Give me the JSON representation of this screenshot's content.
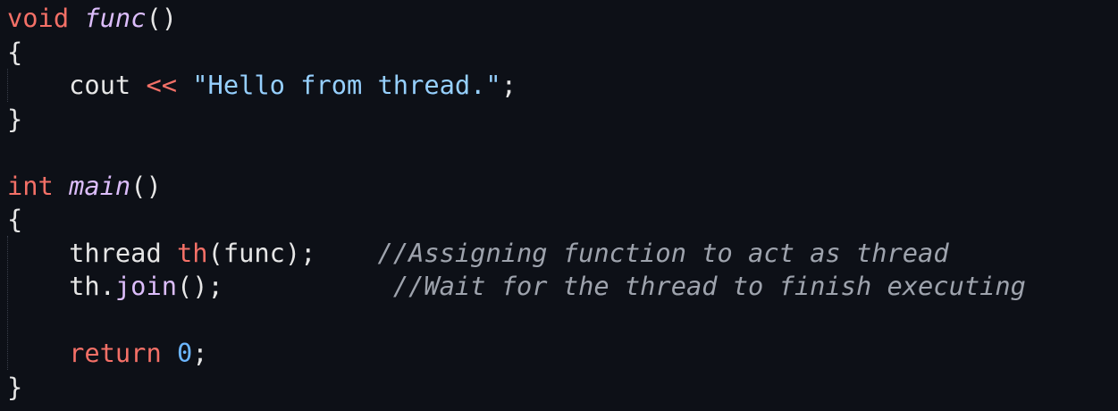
{
  "editor": {
    "lines": [
      [
        {
          "text": "void",
          "cls": "kw",
          "name": "keyword-token"
        },
        {
          "text": " ",
          "cls": "plain",
          "name": "whitespace-token"
        },
        {
          "text": "func",
          "cls": "fn",
          "name": "function-name-token"
        },
        {
          "text": "()",
          "cls": "plain",
          "name": "punctuation-token"
        }
      ],
      [
        {
          "text": "{",
          "cls": "plain",
          "name": "brace-token"
        }
      ],
      [
        {
          "text": "    cout ",
          "cls": "plain",
          "name": "identifier-token"
        },
        {
          "text": "<<",
          "cls": "op",
          "name": "operator-token"
        },
        {
          "text": " ",
          "cls": "plain",
          "name": "whitespace-token"
        },
        {
          "text": "\"Hello from thread.\"",
          "cls": "str",
          "name": "string-token"
        },
        {
          "text": ";",
          "cls": "plain",
          "name": "punctuation-token"
        }
      ],
      [
        {
          "text": "}",
          "cls": "plain",
          "name": "brace-token"
        }
      ],
      [],
      [
        {
          "text": "int",
          "cls": "kw",
          "name": "keyword-token"
        },
        {
          "text": " ",
          "cls": "plain",
          "name": "whitespace-token"
        },
        {
          "text": "main",
          "cls": "fn",
          "name": "function-name-token"
        },
        {
          "text": "()",
          "cls": "plain",
          "name": "punctuation-token"
        }
      ],
      [
        {
          "text": "{",
          "cls": "plain",
          "name": "brace-token"
        }
      ],
      [
        {
          "text": "    thread ",
          "cls": "plain",
          "name": "type-token"
        },
        {
          "text": "th",
          "cls": "var",
          "name": "variable-token"
        },
        {
          "text": "(func);    ",
          "cls": "plain",
          "name": "punctuation-token"
        },
        {
          "text": "//Assigning function to act as thread",
          "cls": "cmt",
          "name": "comment-token"
        }
      ],
      [
        {
          "text": "    th.",
          "cls": "plain",
          "name": "identifier-token"
        },
        {
          "text": "join",
          "cls": "call",
          "name": "method-call-token"
        },
        {
          "text": "();           ",
          "cls": "plain",
          "name": "punctuation-token"
        },
        {
          "text": "//Wait for the thread to finish executing",
          "cls": "cmt",
          "name": "comment-token"
        }
      ],
      [],
      [
        {
          "text": "    ",
          "cls": "plain",
          "name": "whitespace-token"
        },
        {
          "text": "return",
          "cls": "kw",
          "name": "keyword-token"
        },
        {
          "text": " ",
          "cls": "plain",
          "name": "whitespace-token"
        },
        {
          "text": "0",
          "cls": "num",
          "name": "number-token"
        },
        {
          "text": ";",
          "cls": "plain",
          "name": "punctuation-token"
        }
      ],
      [
        {
          "text": "}",
          "cls": "plain",
          "name": "brace-token"
        }
      ]
    ]
  }
}
